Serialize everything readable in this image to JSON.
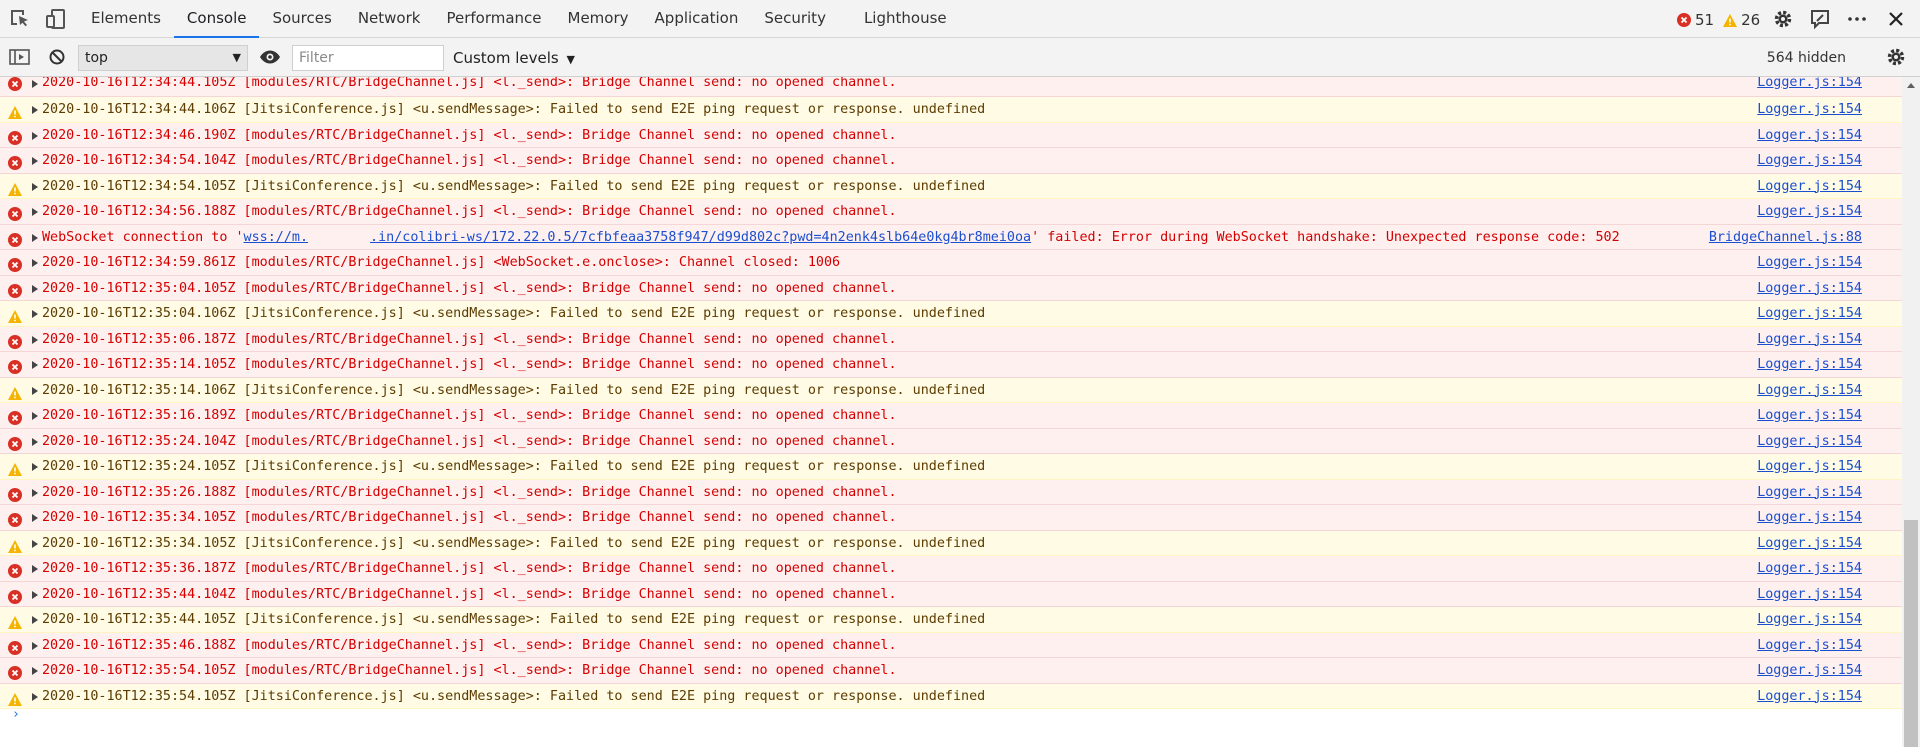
{
  "tabs": [
    {
      "label": "Elements",
      "active": false
    },
    {
      "label": "Console",
      "active": true
    },
    {
      "label": "Sources",
      "active": false
    },
    {
      "label": "Network",
      "active": false
    },
    {
      "label": "Performance",
      "active": false
    },
    {
      "label": "Memory",
      "active": false
    },
    {
      "label": "Application",
      "active": false
    },
    {
      "label": "Security",
      "active": false
    },
    {
      "label": "Lighthouse",
      "active": false
    }
  ],
  "counts": {
    "errors": "51",
    "warnings": "26"
  },
  "toolbar": {
    "context": "top",
    "filter_placeholder": "Filter",
    "levels_label": "Custom levels",
    "hidden_label": "564 hidden"
  },
  "colors": {
    "error": "#d40000",
    "warning": "#f5b400",
    "link": "#1a4fd0",
    "accent": "#1a73e8"
  },
  "icons": [
    "inspect-icon",
    "device-icon",
    "sidebar-toggle-icon",
    "clear-icon",
    "eye-icon",
    "gear-icon",
    "feedback-icon",
    "more-icon",
    "close-icon",
    "error-icon",
    "warning-icon"
  ],
  "messages": [
    {
      "level": "error",
      "text": "2020-10-16T12:34:44.105Z [modules/RTC/BridgeChannel.js] <l._send>:  Bridge Channel send: no opened channel.",
      "source": "Logger.js:154"
    },
    {
      "level": "warning",
      "text": "2020-10-16T12:34:44.106Z [JitsiConference.js] <u.sendMessage>:  Failed to send E2E ping request or response. undefined",
      "source": "Logger.js:154"
    },
    {
      "level": "error",
      "text": "2020-10-16T12:34:46.190Z [modules/RTC/BridgeChannel.js] <l._send>:  Bridge Channel send: no opened channel.",
      "source": "Logger.js:154"
    },
    {
      "level": "error",
      "text": "2020-10-16T12:34:54.104Z [modules/RTC/BridgeChannel.js] <l._send>:  Bridge Channel send: no opened channel.",
      "source": "Logger.js:154"
    },
    {
      "level": "warning",
      "text": "2020-10-16T12:34:54.105Z [JitsiConference.js] <u.sendMessage>:  Failed to send E2E ping request or response. undefined",
      "source": "Logger.js:154"
    },
    {
      "level": "error",
      "text": "2020-10-16T12:34:56.188Z [modules/RTC/BridgeChannel.js] <l._send>:  Bridge Channel send: no opened channel.",
      "source": "Logger.js:154"
    },
    {
      "level": "error",
      "websocket": true,
      "prefix": "WebSocket connection to '",
      "url_start": "wss://m.",
      "url_end": ".in/colibri-ws/172.22.0.5/7cfbfeaa3758f947/d99d802c?pwd=4n2enk4slb64e0kg4br8mei0oa",
      "suffix": "' failed: Error during WebSocket handshake: Unexpected response code: 502",
      "source": "BridgeChannel.js:88"
    },
    {
      "level": "error",
      "text": "2020-10-16T12:34:59.861Z [modules/RTC/BridgeChannel.js] <WebSocket.e.onclose>:  Channel closed: 1006",
      "source": "Logger.js:154"
    },
    {
      "level": "error",
      "text": "2020-10-16T12:35:04.105Z [modules/RTC/BridgeChannel.js] <l._send>:  Bridge Channel send: no opened channel.",
      "source": "Logger.js:154"
    },
    {
      "level": "warning",
      "text": "2020-10-16T12:35:04.106Z [JitsiConference.js] <u.sendMessage>:  Failed to send E2E ping request or response. undefined",
      "source": "Logger.js:154"
    },
    {
      "level": "error",
      "text": "2020-10-16T12:35:06.187Z [modules/RTC/BridgeChannel.js] <l._send>:  Bridge Channel send: no opened channel.",
      "source": "Logger.js:154"
    },
    {
      "level": "error",
      "text": "2020-10-16T12:35:14.105Z [modules/RTC/BridgeChannel.js] <l._send>:  Bridge Channel send: no opened channel.",
      "source": "Logger.js:154"
    },
    {
      "level": "warning",
      "text": "2020-10-16T12:35:14.106Z [JitsiConference.js] <u.sendMessage>:  Failed to send E2E ping request or response. undefined",
      "source": "Logger.js:154"
    },
    {
      "level": "error",
      "text": "2020-10-16T12:35:16.189Z [modules/RTC/BridgeChannel.js] <l._send>:  Bridge Channel send: no opened channel.",
      "source": "Logger.js:154"
    },
    {
      "level": "error",
      "text": "2020-10-16T12:35:24.104Z [modules/RTC/BridgeChannel.js] <l._send>:  Bridge Channel send: no opened channel.",
      "source": "Logger.js:154"
    },
    {
      "level": "warning",
      "text": "2020-10-16T12:35:24.105Z [JitsiConference.js] <u.sendMessage>:  Failed to send E2E ping request or response. undefined",
      "source": "Logger.js:154"
    },
    {
      "level": "error",
      "text": "2020-10-16T12:35:26.188Z [modules/RTC/BridgeChannel.js] <l._send>:  Bridge Channel send: no opened channel.",
      "source": "Logger.js:154"
    },
    {
      "level": "error",
      "text": "2020-10-16T12:35:34.105Z [modules/RTC/BridgeChannel.js] <l._send>:  Bridge Channel send: no opened channel.",
      "source": "Logger.js:154"
    },
    {
      "level": "warning",
      "text": "2020-10-16T12:35:34.105Z [JitsiConference.js] <u.sendMessage>:  Failed to send E2E ping request or response. undefined",
      "source": "Logger.js:154"
    },
    {
      "level": "error",
      "text": "2020-10-16T12:35:36.187Z [modules/RTC/BridgeChannel.js] <l._send>:  Bridge Channel send: no opened channel.",
      "source": "Logger.js:154"
    },
    {
      "level": "error",
      "text": "2020-10-16T12:35:44.104Z [modules/RTC/BridgeChannel.js] <l._send>:  Bridge Channel send: no opened channel.",
      "source": "Logger.js:154"
    },
    {
      "level": "warning",
      "text": "2020-10-16T12:35:44.105Z [JitsiConference.js] <u.sendMessage>:  Failed to send E2E ping request or response. undefined",
      "source": "Logger.js:154"
    },
    {
      "level": "error",
      "text": "2020-10-16T12:35:46.188Z [modules/RTC/BridgeChannel.js] <l._send>:  Bridge Channel send: no opened channel.",
      "source": "Logger.js:154"
    },
    {
      "level": "error",
      "text": "2020-10-16T12:35:54.105Z [modules/RTC/BridgeChannel.js] <l._send>:  Bridge Channel send: no opened channel.",
      "source": "Logger.js:154"
    },
    {
      "level": "warning",
      "text": "2020-10-16T12:35:54.105Z [JitsiConference.js] <u.sendMessage>:  Failed to send E2E ping request or response. undefined",
      "source": "Logger.js:154"
    }
  ],
  "prompt": "›"
}
